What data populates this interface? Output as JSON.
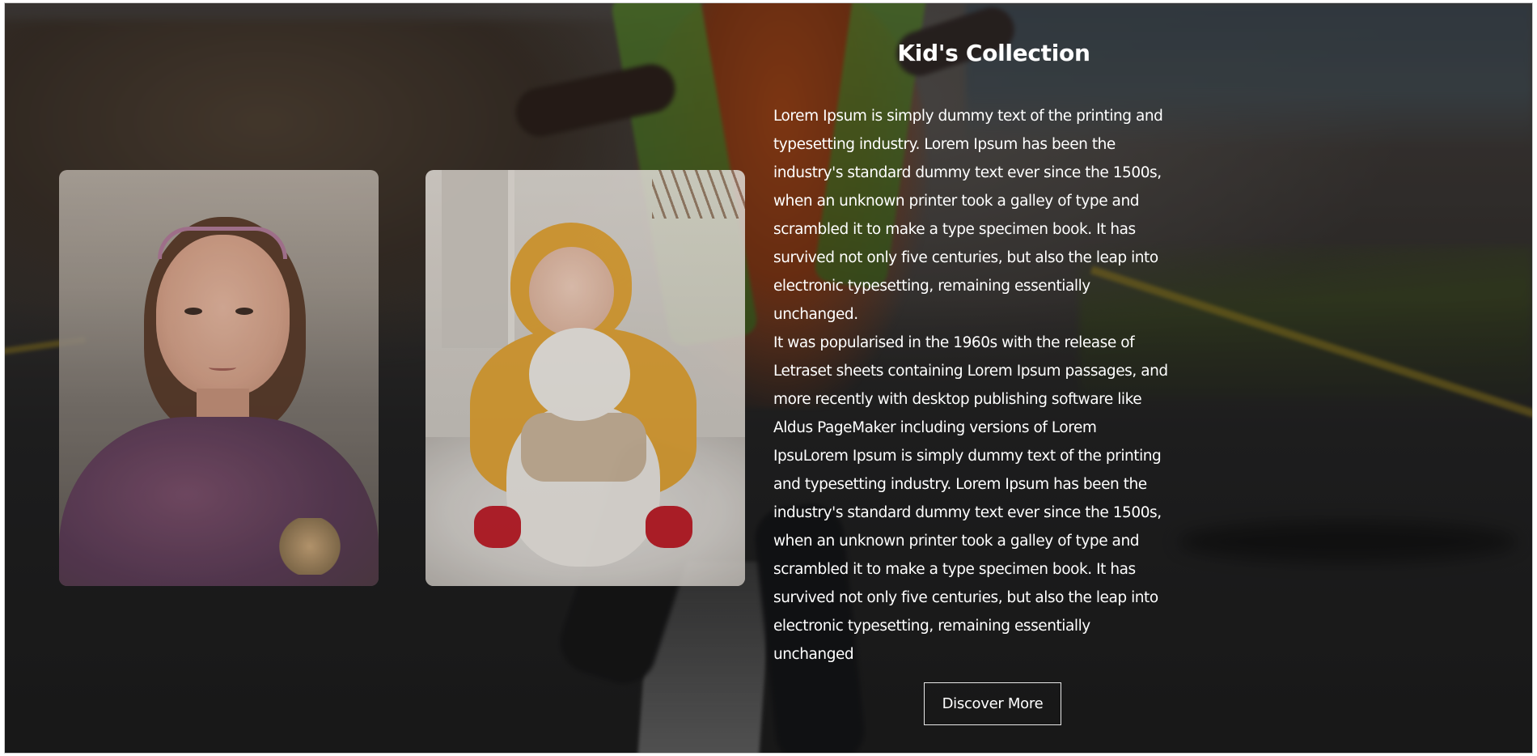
{
  "section": {
    "title": "Kid's Collection",
    "paragraphs": [
      "Lorem Ipsum is simply dummy text of the printing and\ntypesetting industry. Lorem Ipsum has been the\nindustry's standard dummy text ever since the 1500s,\nwhen an unknown printer took a galley of type and\nscrambled it to make a type specimen book. It has\nsurvived not only five centuries, but also the leap into\nelectronic typesetting, remaining essentially\nunchanged.",
      "It was popularised in the 1960s with the release of\nLetraset sheets containing Lorem Ipsum passages, and\nmore recently with desktop publishing software like\nAldus PageMaker including versions of Lorem\nIpsuLorem Ipsum is simply dummy text of the printing\nand typesetting industry. Lorem Ipsum has been the\nindustry's standard dummy text ever since the 1500s,\nwhen an unknown printer took a galley of type and\nscrambled it to make a type specimen book. It has\nsurvived not only five centuries, but also the leap into\nelectronic typesetting, remaining essentially\nunchanged"
    ],
    "button_label": "Discover More"
  },
  "images": [
    {
      "name": "girl-photo",
      "subject": "girl"
    },
    {
      "name": "baby-photo",
      "subject": "baby with teddy bear"
    }
  ],
  "colors": {
    "text": "#ffffff",
    "button_border": "#e8e8e8",
    "overlay": "rgba(0,0,0,0.38)"
  }
}
